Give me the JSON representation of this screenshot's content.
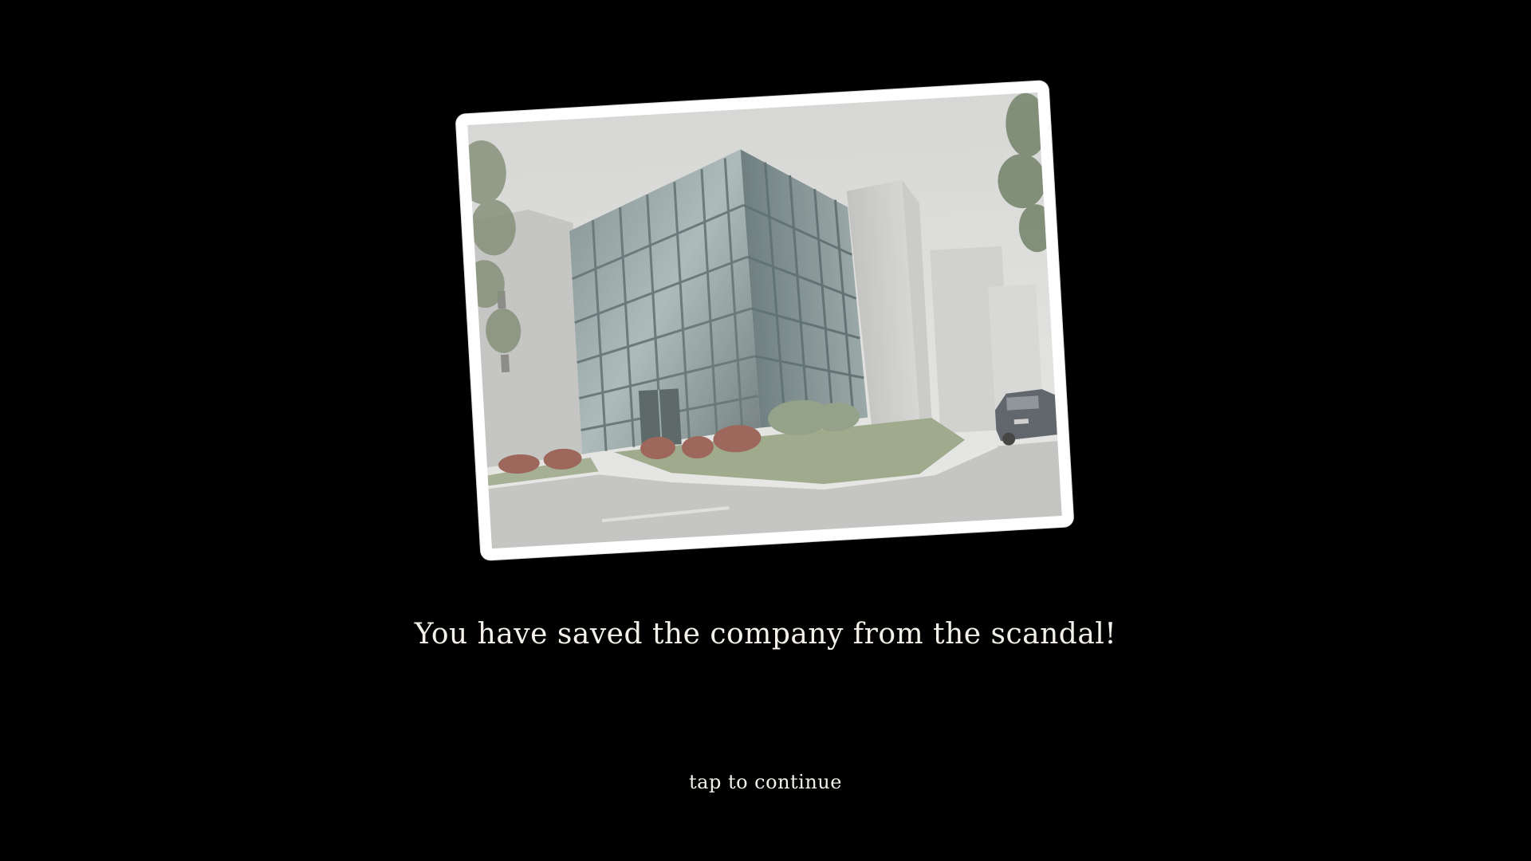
{
  "scene": {
    "message": "You have saved the company from the scandal!",
    "prompt": "tap to continue",
    "photo_subject": "office-building-photo"
  },
  "colors": {
    "background": "#000000",
    "text": "#f4f1ea",
    "card": "#ffffff"
  }
}
